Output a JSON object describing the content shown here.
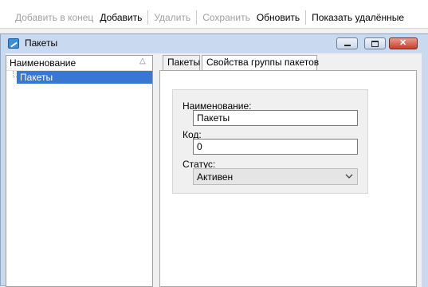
{
  "toolbar": {
    "items": [
      {
        "label": "Добавить в конец",
        "enabled": false
      },
      {
        "label": "Добавить",
        "enabled": true
      },
      {
        "label": "Удалить",
        "enabled": false
      },
      {
        "label": "Сохранить",
        "enabled": false
      },
      {
        "label": "Обновить",
        "enabled": true
      },
      {
        "label": "Показать удалённые",
        "enabled": true
      }
    ]
  },
  "window": {
    "title": "Пакеты",
    "icon": "app-icon"
  },
  "tree": {
    "column_header": "Наименование",
    "sort_icon": "sort-ascending-icon",
    "rows": [
      {
        "label": "Пакеты",
        "selected": true
      }
    ]
  },
  "tabs": [
    {
      "label": "Пакеты",
      "active": false
    },
    {
      "label": "Свойства группы пакетов",
      "active": true
    }
  ],
  "form": {
    "name_label": "Наименование:",
    "name_value": "Пакеты",
    "code_label": "Код:",
    "code_value": "0",
    "status_label": "Статус:",
    "status_value": "Активен"
  },
  "colors": {
    "selection": "#3878d2",
    "window_frame": "#c9daf0",
    "disabled_text": "#a0a0a0"
  }
}
